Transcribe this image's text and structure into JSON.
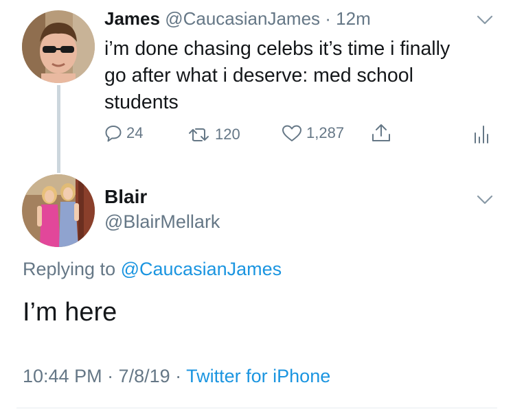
{
  "parent_tweet": {
    "author_name": "James",
    "author_handle": "@CaucasianJames",
    "separator": "·",
    "time": "12m",
    "text_lines": [
      "i’m done chasing celebs it’s time i finally",
      "go after what i deserve: med school",
      "students"
    ],
    "actions": {
      "reply_count": "24",
      "retweet_count": "120",
      "like_count": "1,287"
    },
    "icons": [
      "reply-icon",
      "retweet-icon",
      "like-icon",
      "share-icon",
      "analytics-icon",
      "chevron-down-icon"
    ]
  },
  "reply_tweet": {
    "author_name": "Blair",
    "author_handle": "@BlairMellark",
    "replying_prefix": "Replying to",
    "replying_handle": "@CaucasianJames",
    "text": "I’m here",
    "timestamp": "10:44 PM · 7/8/19 ·",
    "source": "Twitter for iPhone"
  },
  "colors": {
    "link": "#1b95e0",
    "muted": "#657786",
    "text": "#14171a",
    "thread_line": "#ccd6dd",
    "divider": "#e6ecf0"
  }
}
